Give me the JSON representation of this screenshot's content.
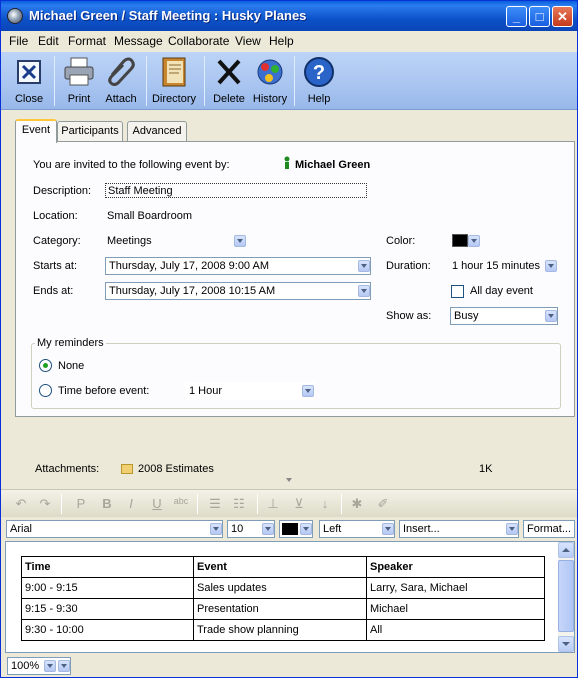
{
  "window": {
    "title": "Michael Green / Staff Meeting : Husky Planes"
  },
  "menu": [
    "File",
    "Edit",
    "Format",
    "Message",
    "Collaborate",
    "View",
    "Help"
  ],
  "toolbar": {
    "close": "Close",
    "print": "Print",
    "attach": "Attach",
    "directory": "Directory",
    "delete": "Delete",
    "history": "History",
    "help": "Help"
  },
  "tabs": [
    "Event",
    "Participants",
    "Advanced"
  ],
  "event": {
    "invited_label": "You are invited to the following event by:",
    "organizer": "Michael Green",
    "description_label": "Description:",
    "description": "Staff Meeting",
    "location_label": "Location:",
    "location": "Small Boardroom",
    "category_label": "Category:",
    "category": "Meetings",
    "color_label": "Color:",
    "starts_label": "Starts at:",
    "starts": "Thursday, July 17, 2008 9:00 AM",
    "duration_label": "Duration:",
    "duration": "1 hour 15 minutes",
    "ends_label": "Ends at:",
    "ends": "Thursday, July 17, 2008 10:15 AM",
    "all_day_label": "All day event",
    "show_as_label": "Show as:",
    "show_as": "Busy"
  },
  "reminders": {
    "legend": "My reminders",
    "none_label": "None",
    "before_label": "Time before event:",
    "before_value": "1 Hour"
  },
  "attachments": {
    "label": "Attachments:",
    "file": "2008 Estimates",
    "size": "1K"
  },
  "format": {
    "font": "Arial",
    "size": "10",
    "align": "Left",
    "insert": "Insert...",
    "format_btn": "Format..."
  },
  "schedule": {
    "headers": [
      "Time",
      "Event",
      "Speaker"
    ],
    "rows": [
      [
        "9:00 - 9:15",
        "Sales updates",
        "Larry, Sara, Michael"
      ],
      [
        "9:15 - 9:30",
        "Presentation",
        "Michael"
      ],
      [
        "9:30 - 10:00",
        "Trade show planning",
        "All"
      ]
    ]
  },
  "status": {
    "zoom": "100%"
  }
}
